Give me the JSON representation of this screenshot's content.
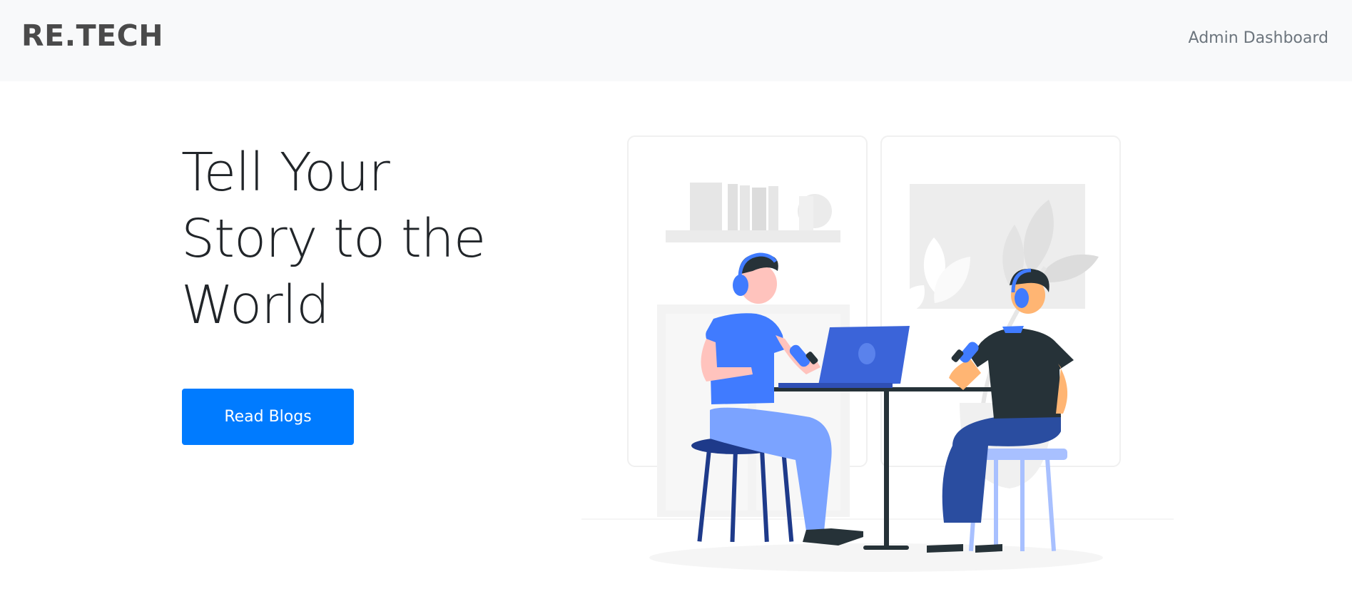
{
  "navbar": {
    "brand": "RE.TECH",
    "admin_link": "Admin Dashboard"
  },
  "hero": {
    "title": "Tell Your Story to the World",
    "button_label": "Read Blogs"
  },
  "colors": {
    "navbar_bg": "#f8f9fa",
    "primary": "#007bff",
    "brand_text": "#4a4a4a",
    "title_text": "#212529",
    "link_text": "#6c757d",
    "illustration_blue": "#407bff",
    "illustration_dark": "#263238"
  },
  "illustration": {
    "subject": "podcast-recording-illustration"
  }
}
